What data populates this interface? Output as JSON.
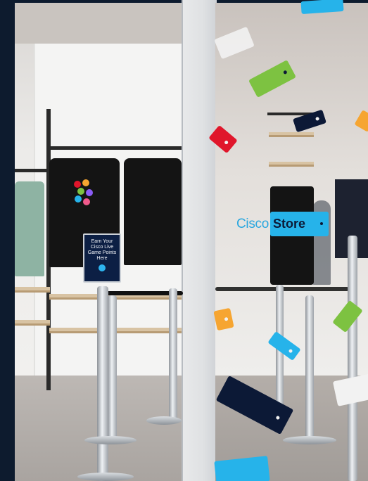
{
  "scene": {
    "description_alt": "Cisco Store entrance with merchandise racks and stanchions",
    "sign_text": [
      "Earn Your",
      "Cisco Live",
      "Game Points",
      "Here"
    ],
    "logo": {
      "brand": "Cisco",
      "label": "Store"
    }
  },
  "colors": {
    "navy": "#0d1b2e",
    "store_blue": "#26b3ea",
    "tag_green": "#7dc241",
    "tag_red": "#e0162b",
    "tag_orange": "#f6a531",
    "tag_navy": "#0c1936",
    "tag_white": "#f2f2f2"
  },
  "icons": [
    "hang-tag-icon"
  ]
}
